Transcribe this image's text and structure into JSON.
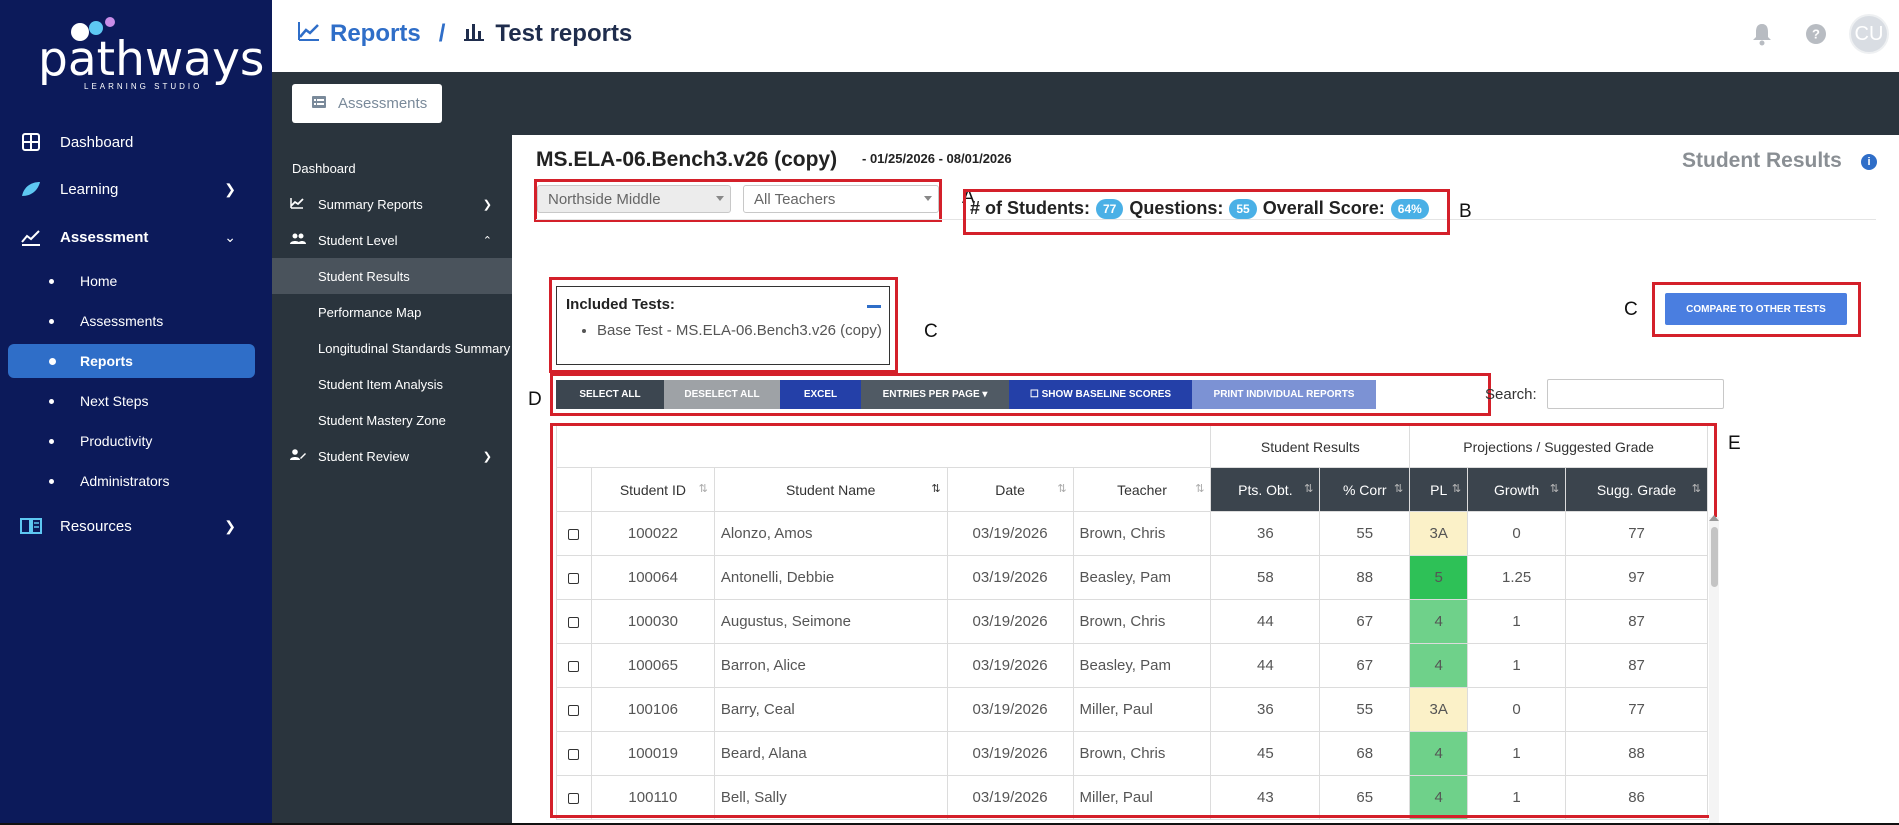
{
  "brand": {
    "name": "pathways",
    "tagline": "LEARNING STUDIO"
  },
  "leftnav": {
    "dashboard": "Dashboard",
    "learning": "Learning",
    "assessment": "Assessment",
    "sub": [
      "Home",
      "Assessments",
      "Reports",
      "Next Steps",
      "Productivity",
      "Administrators"
    ],
    "resources": "Resources"
  },
  "header": {
    "crumb1": "Reports",
    "sep": "/",
    "crumb2": "Test reports",
    "avatar": "CU",
    "help": "?"
  },
  "strip": {
    "tab": "Assessments"
  },
  "subnav": {
    "dashboard": "Dashboard",
    "summary": "Summary Reports",
    "student_level": "Student Level",
    "children": [
      "Student Results",
      "Performance Map",
      "Longitudinal Standards Summary",
      "Student Item Analysis",
      "Student Mastery Zone"
    ],
    "student_review": "Student Review"
  },
  "main": {
    "title": "MS.ELA-06.Bench3.v26 (copy)",
    "date_range": "- 01/25/2026 - 08/01/2026",
    "page_name": "Student Results",
    "info": "i",
    "school_select": "Northside Middle",
    "teacher_select": "All Teachers",
    "stats": {
      "students_label": "# of Students:",
      "students": "77",
      "questions_label": "Questions:",
      "questions": "55",
      "score_label": "Overall Score:",
      "score": "64%"
    },
    "included": {
      "heading": "Included Tests:",
      "item": "Base Test - MS.ELA-06.Bench3.v26 (copy)"
    },
    "compare_btn": "COMPARE TO OTHER TESTS",
    "buttons": [
      "SELECT ALL",
      "DESELECT ALL",
      "EXCEL",
      "ENTRIES PER PAGE ▾",
      "☐ SHOW BASELINE SCORES",
      "PRINT INDIVIDUAL REPORTS"
    ],
    "search_label": "Search:",
    "markers": {
      "a": "A",
      "b": "B",
      "c1": "C",
      "c2": "C",
      "d": "D",
      "e": "E"
    }
  },
  "table": {
    "group_headers": [
      "Student Results",
      "Projections / Suggested Grade"
    ],
    "columns": [
      "Student ID",
      "Student Name",
      "Date",
      "Teacher",
      "Pts. Obt.",
      "% Corr",
      "PL",
      "Growth",
      "Sugg. Grade"
    ],
    "rows": [
      [
        "100022",
        "Alonzo, Amos",
        "03/19/2026",
        "Brown, Chris",
        "36",
        "55",
        "3A",
        "0",
        "77"
      ],
      [
        "100064",
        "Antonelli, Debbie",
        "03/19/2026",
        "Beasley, Pam",
        "58",
        "88",
        "5",
        "1.25",
        "97"
      ],
      [
        "100030",
        "Augustus, Seimone",
        "03/19/2026",
        "Brown, Chris",
        "44",
        "67",
        "4",
        "1",
        "87"
      ],
      [
        "100065",
        "Barron, Alice",
        "03/19/2026",
        "Beasley, Pam",
        "44",
        "67",
        "4",
        "1",
        "87"
      ],
      [
        "100106",
        "Barry, Ceal",
        "03/19/2026",
        "Miller, Paul",
        "36",
        "55",
        "3A",
        "0",
        "77"
      ],
      [
        "100019",
        "Beard, Alana",
        "03/19/2026",
        "Brown, Chris",
        "45",
        "68",
        "4",
        "1",
        "88"
      ],
      [
        "100110",
        "Bell, Sally",
        "03/19/2026",
        "Miller, Paul",
        "43",
        "65",
        "4",
        "1",
        "86"
      ]
    ]
  },
  "colors": {
    "nav_bg": "#0c1a5a",
    "accent": "#2f6ec8",
    "dark_panel": "#2a343d",
    "pl_3A": "#fbf1c8",
    "pl_4": "#6fd18a",
    "pl_5": "#2ec157",
    "callout": "#d4202a",
    "pill": "#4ab0e6"
  }
}
